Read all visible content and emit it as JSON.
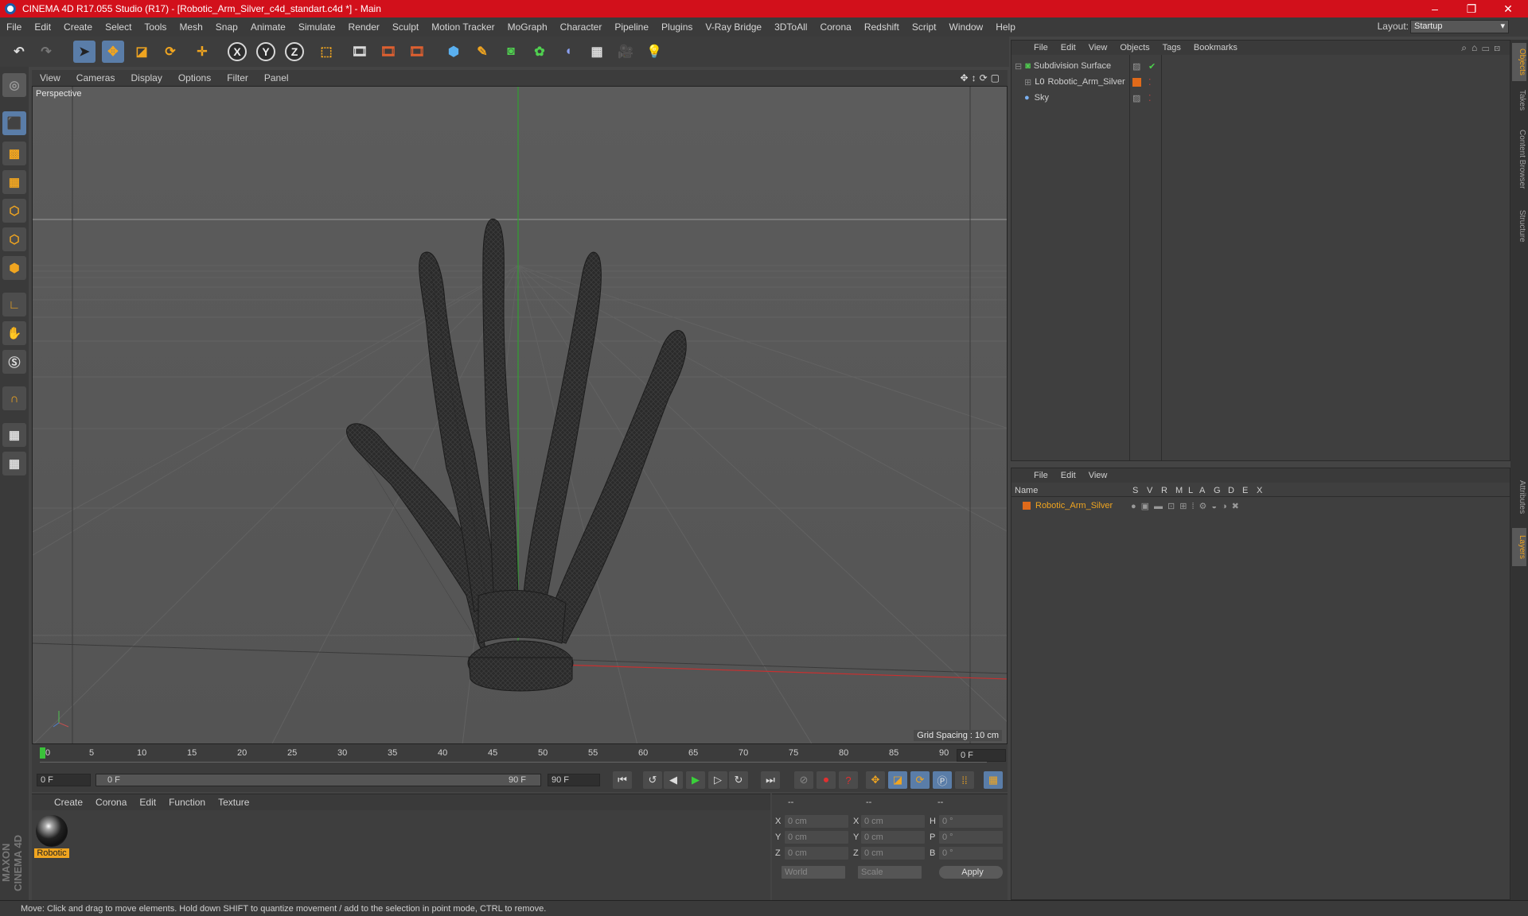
{
  "window": {
    "title": "CINEMA 4D R17.055 Studio (R17) - [Robotic_Arm_Silver_c4d_standart.c4d *] - Main",
    "minimize": "–",
    "maximize": "❐",
    "close": "✕"
  },
  "menu": [
    "File",
    "Edit",
    "Create",
    "Select",
    "Tools",
    "Mesh",
    "Snap",
    "Animate",
    "Simulate",
    "Render",
    "Sculpt",
    "Motion Tracker",
    "MoGraph",
    "Character",
    "Pipeline",
    "Plugins",
    "V-Ray Bridge",
    "3DToAll",
    "Corona",
    "Redshift",
    "Script",
    "Window",
    "Help"
  ],
  "layout": {
    "label": "Layout:",
    "value": "Startup"
  },
  "toolbar": {
    "x": "X",
    "y": "Y",
    "z": "Z"
  },
  "viewport": {
    "menu": [
      "View",
      "Cameras",
      "Display",
      "Options",
      "Filter",
      "Panel"
    ],
    "label": "Perspective",
    "grid_spacing": "Grid Spacing : 10 cm"
  },
  "timeline": {
    "ticks": [
      "0",
      "5",
      "10",
      "15",
      "20",
      "25",
      "30",
      "35",
      "40",
      "45",
      "50",
      "55",
      "60",
      "65",
      "70",
      "75",
      "80",
      "85",
      "90"
    ],
    "current": "0 F",
    "start": "0 F",
    "slider_start": "0 F",
    "slider_end": "90 F",
    "end": "90 F"
  },
  "material": {
    "menu": [
      "Create",
      "Corona",
      "Edit",
      "Function",
      "Texture"
    ],
    "item": "Robotic"
  },
  "coords": {
    "headers": [
      "--",
      "--",
      "--"
    ],
    "rows": [
      {
        "a": "X",
        "av": "0 cm",
        "b": "X",
        "bv": "0 cm",
        "c": "H",
        "cv": "0 °"
      },
      {
        "a": "Y",
        "av": "0 cm",
        "b": "Y",
        "bv": "0 cm",
        "c": "P",
        "cv": "0 °"
      },
      {
        "a": "Z",
        "av": "0 cm",
        "b": "Z",
        "bv": "0 cm",
        "c": "B",
        "cv": "0 °"
      }
    ],
    "world": "World",
    "scale": "Scale",
    "apply": "Apply"
  },
  "objects": {
    "menu": [
      "File",
      "Edit",
      "View",
      "Objects",
      "Tags",
      "Bookmarks"
    ],
    "items": [
      "Subdivision Surface",
      "Robotic_Arm_Silver",
      "Sky"
    ]
  },
  "layers": {
    "menu": [
      "File",
      "Edit",
      "View"
    ],
    "columns": [
      "Name",
      "S",
      "V",
      "R",
      "M",
      "L",
      "A",
      "G",
      "D",
      "E",
      "X"
    ],
    "item": "Robotic_Arm_Silver"
  },
  "right_tabs": [
    "Objects",
    "Takes",
    "Content Browser",
    "Structure",
    "Attributes",
    "Layers"
  ],
  "status": "Move: Click and drag to move elements. Hold down SHIFT to quantize movement / add to the selection in point mode, CTRL to remove.",
  "brand": "MAXON CINEMA 4D",
  "colors": {
    "accent": "#f0a520",
    "selection": "#5a7da8",
    "title_bar": "#d2101b"
  }
}
